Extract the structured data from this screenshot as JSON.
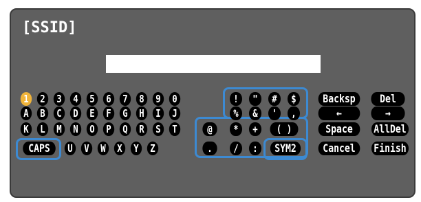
{
  "title": "[SSID]",
  "input": {
    "value": ""
  },
  "colors": {
    "panel": "#5f5f5f",
    "key": "#000000",
    "selected": "#f0b43a",
    "highlight": "#3d8ad2"
  },
  "keys": {
    "row1": [
      "1",
      "2",
      "3",
      "4",
      "5",
      "6",
      "7",
      "8",
      "9",
      "0"
    ],
    "row2": [
      "A",
      "B",
      "C",
      "D",
      "E",
      "F",
      "G",
      "H",
      "I",
      "J"
    ],
    "row3": [
      "K",
      "L",
      "M",
      "N",
      "O",
      "P",
      "Q",
      "R",
      "S",
      "T"
    ],
    "row4": [
      "U",
      "V",
      "W",
      "X",
      "Y",
      "Z"
    ],
    "sym1": [
      "!",
      "\"",
      "#",
      "$"
    ],
    "sym2": [
      "%",
      "&",
      "'",
      ","
    ],
    "sym3": [
      "@",
      "*",
      "+",
      "( )"
    ],
    "sym4": [
      ".",
      "/",
      ":"
    ],
    "caps": "CAPS",
    "sym_toggle": "SYM2",
    "backspace": "Backsp",
    "delete": "Del",
    "left_arrow": "←",
    "right_arrow": "→",
    "space": "Space",
    "alldel": "AllDel",
    "cancel": "Cancel",
    "finish": "Finish"
  }
}
